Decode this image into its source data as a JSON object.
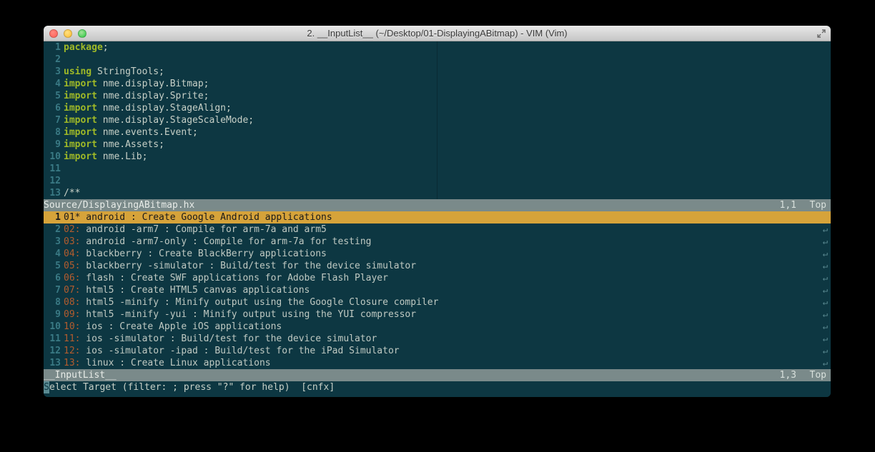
{
  "window": {
    "title": "2. __InputList__ (~/Desktop/01-DisplayingABitmap) - VIM (Vim)"
  },
  "topPane": {
    "lines": [
      {
        "n": "1",
        "tokens": [
          {
            "t": "package",
            "c": "kw"
          },
          {
            "t": ";",
            "c": "txt"
          }
        ]
      },
      {
        "n": "2",
        "tokens": []
      },
      {
        "n": "3",
        "tokens": [
          {
            "t": "using ",
            "c": "kw"
          },
          {
            "t": "StringTools;",
            "c": "txt"
          }
        ]
      },
      {
        "n": "4",
        "tokens": [
          {
            "t": "import ",
            "c": "kw"
          },
          {
            "t": "nme.display.Bitmap;",
            "c": "txt"
          }
        ]
      },
      {
        "n": "5",
        "tokens": [
          {
            "t": "import ",
            "c": "kw"
          },
          {
            "t": "nme.display.Sprite;",
            "c": "txt"
          }
        ]
      },
      {
        "n": "6",
        "tokens": [
          {
            "t": "import ",
            "c": "kw"
          },
          {
            "t": "nme.display.StageAlign;",
            "c": "txt"
          }
        ]
      },
      {
        "n": "7",
        "tokens": [
          {
            "t": "import ",
            "c": "kw"
          },
          {
            "t": "nme.display.StageScaleMode;",
            "c": "txt"
          }
        ]
      },
      {
        "n": "8",
        "tokens": [
          {
            "t": "import ",
            "c": "kw"
          },
          {
            "t": "nme.events.Event;",
            "c": "txt"
          }
        ]
      },
      {
        "n": "9",
        "tokens": [
          {
            "t": "import ",
            "c": "kw"
          },
          {
            "t": "nme.Assets;",
            "c": "txt"
          }
        ]
      },
      {
        "n": "10",
        "tokens": [
          {
            "t": "import ",
            "c": "kw"
          },
          {
            "t": "nme.Lib;",
            "c": "txt"
          }
        ]
      },
      {
        "n": "11",
        "tokens": []
      },
      {
        "n": "12",
        "tokens": []
      },
      {
        "n": "13",
        "tokens": [
          {
            "t": "/**",
            "c": "txt"
          }
        ]
      }
    ],
    "status": {
      "left": "Source/DisplayingABitmap.hx",
      "mid": "1,1",
      "right": "Top"
    }
  },
  "bottomPane": {
    "lines": [
      {
        "n": "1",
        "sel": true,
        "idx": "01*",
        "text": " android : Create Google Android applications"
      },
      {
        "n": "2",
        "idx": "02:",
        "text": " android -arm7 : Compile for arm-7a and arm5"
      },
      {
        "n": "3",
        "idx": "03:",
        "text": " android -arm7-only : Compile for arm-7a for testing"
      },
      {
        "n": "4",
        "idx": "04:",
        "text": " blackberry : Create BlackBerry applications"
      },
      {
        "n": "5",
        "idx": "05:",
        "text": " blackberry -simulator : Build/test for the device simulator"
      },
      {
        "n": "6",
        "idx": "06:",
        "text": " flash : Create SWF applications for Adobe Flash Player"
      },
      {
        "n": "7",
        "idx": "07:",
        "text": " html5 : Create HTML5 canvas applications"
      },
      {
        "n": "8",
        "idx": "08:",
        "text": " html5 -minify : Minify output using the Google Closure compiler"
      },
      {
        "n": "9",
        "idx": "09:",
        "text": " html5 -minify -yui : Minify output using the YUI compressor"
      },
      {
        "n": "10",
        "idx": "10:",
        "text": " ios : Create Apple iOS applications"
      },
      {
        "n": "11",
        "idx": "11:",
        "text": " ios -simulator : Build/test for the device simulator"
      },
      {
        "n": "12",
        "idx": "12:",
        "text": " ios -simulator -ipad : Build/test for the iPad Simulator"
      },
      {
        "n": "13",
        "idx": "13:",
        "text": " linux : Create Linux applications"
      }
    ],
    "status": {
      "left": "__InputList__",
      "mid": "1,3",
      "right": "Top"
    }
  },
  "cmdline": {
    "cursor": "S",
    "text": "elect Target (filter: ; press \"?\" for help)  [cnfx]"
  }
}
